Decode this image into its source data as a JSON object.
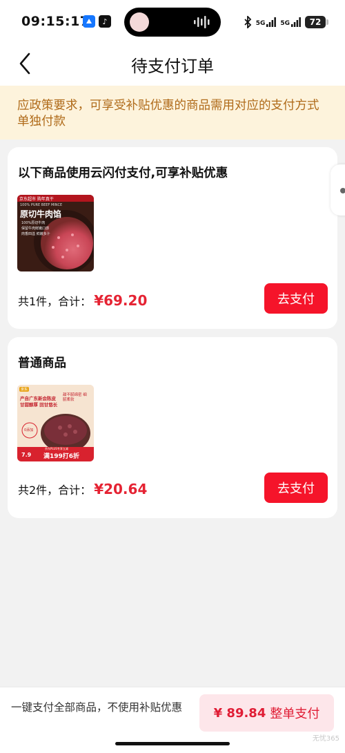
{
  "status_bar": {
    "time": "09:15:17",
    "network_1": "5G",
    "network_2": "5G",
    "battery": "72"
  },
  "nav": {
    "title": "待支付订单"
  },
  "notice": {
    "text": "应政策要求，可享受补贴优惠的商品需用对应的支付方式单独付款"
  },
  "orders": [
    {
      "title": "以下商品使用云闪付支付,可享补贴优惠",
      "summary_label": "共1件，合计：",
      "price": "¥69.20",
      "pay_label": "去支付",
      "thumb": {
        "top_line": "京东超市 购年真干",
        "subtitle": "100% PURE BEEF MINCE",
        "name": "原切牛肉馅",
        "bullets": [
          "100%原切牛肉",
          "保留牛肉鲜嫩口感",
          "肉香四溢 鲜嫩多汁"
        ]
      }
    },
    {
      "title": "普通商品",
      "summary_label": "共2件，合计：",
      "price": "¥20.64",
      "pay_label": "去支付",
      "thumb": {
        "badge": "京东",
        "headline_1": "产自广东新会陈皮",
        "headline_2": "甘甜醇厚 回甘悠长",
        "stamp": "0添加",
        "tag_right": "甜不腻绵密 细腻柔软",
        "price_tag": "7.9",
        "promo": "满199打6折",
        "promo_top": "京东PLUS专享立减"
      }
    }
  ],
  "bottom_bar": {
    "note": "一键支付全部商品，不使用补贴优惠",
    "total": "¥ 89.84",
    "button_label": "整单支付"
  },
  "watermark": "无忧365"
}
